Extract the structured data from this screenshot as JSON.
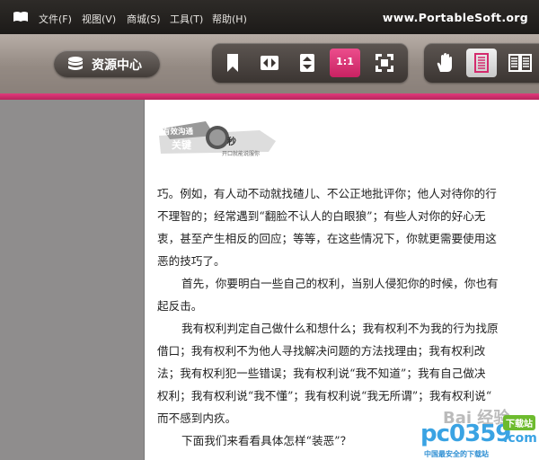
{
  "menubar": {
    "items": [
      "文件(F)",
      "视图(V)",
      "商城(S)",
      "工具(T)",
      "帮助(H)"
    ],
    "brand": "www.PortableSoft.org"
  },
  "toolbar": {
    "resource_center_label": "资源中心",
    "zoom_label": "1:1"
  },
  "document": {
    "logo_text": [
      "有效沟通",
      "关键",
      "秒",
      "开口就能说服你"
    ],
    "lines": [
      "巧。例如，有人动不动就找碴儿、不公正地批评你；他人对待你的行",
      "不理智的；经常遇到“翻脸不认人的白眼狼”；有些人对你的好心无",
      "衷，甚至产生相反的回应；等等，在这些情况下，你就更需要使用这",
      "恶的技巧了。",
      "首先，你要明白一些自己的权利，当别人侵犯你的时候，你也有",
      "起反击。",
      "我有权利判定自己做什么和想什么；我有权利不为我的行为找原",
      "借口；我有权利不为他人寻找解决问题的方法找理由；我有权利改",
      "法；我有权利犯一些错误；我有权利说“我不知道”；我有自己做决",
      "权利；我有权利说“我不懂”；我有权利说“我无所谓”；我有权利说“",
      "而不感到内疚。",
      "下面我们来看看具体怎样“装恶”？"
    ],
    "watermark_baidu": "Bai 经验",
    "watermark_pc": "pc0359",
    "watermark_pc_domain": ".com",
    "watermark_pc_tag": "下载站",
    "watermark_pc_slogan": "中国最安全的下载站"
  },
  "colors": {
    "accent": "#d42a6d",
    "menubar": "#23201e",
    "toolbar": "#a49a93"
  }
}
